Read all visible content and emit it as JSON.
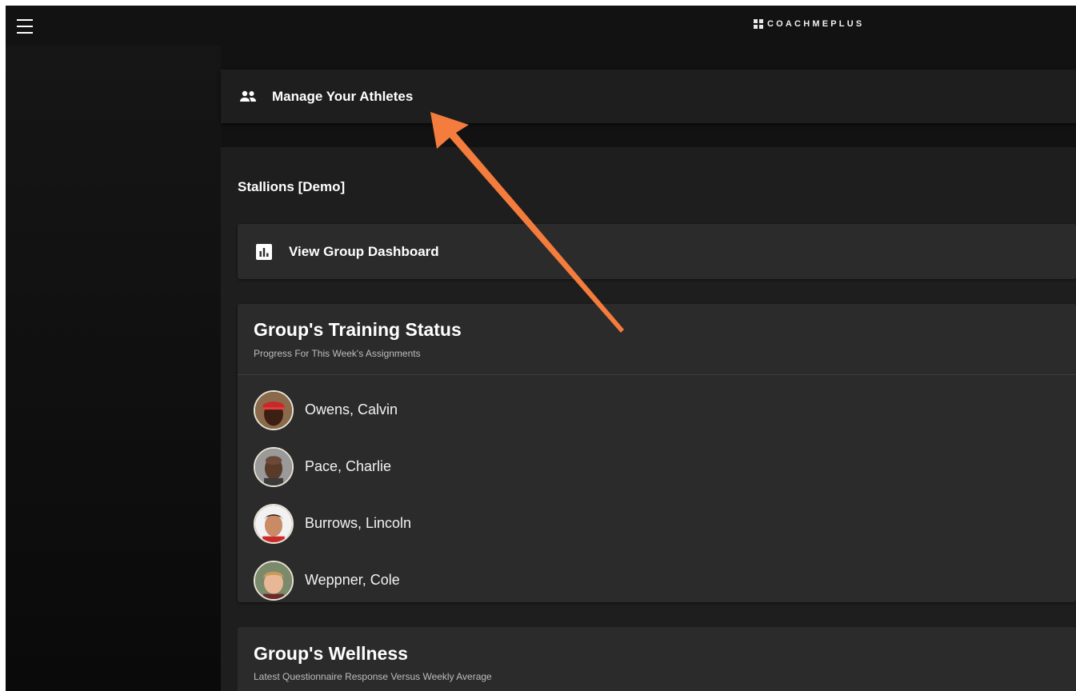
{
  "header": {
    "brand": "COACHMEPLUS",
    "menu_icon": "hamburger-menu-icon"
  },
  "manage": {
    "label": "Manage Your Athletes",
    "icon": "people-icon"
  },
  "group": {
    "name": "Stallions [Demo]",
    "dashboard": {
      "label": "View Group Dashboard",
      "icon": "bar-chart-icon"
    },
    "training": {
      "title": "Group's Training Status",
      "subtitle": "Progress For This Week's Assignments",
      "athletes": [
        {
          "name": "Owens, Calvin"
        },
        {
          "name": "Pace, Charlie"
        },
        {
          "name": "Burrows, Lincoln"
        },
        {
          "name": "Weppner, Cole"
        }
      ]
    },
    "wellness": {
      "title": "Group's Wellness",
      "subtitle": "Latest Questionnaire Response Versus Weekly Average"
    }
  },
  "colors": {
    "background": "#121212",
    "surface": "#1e1e1e",
    "card": "#2b2b2b",
    "annotation_arrow": "#f47c3c"
  }
}
